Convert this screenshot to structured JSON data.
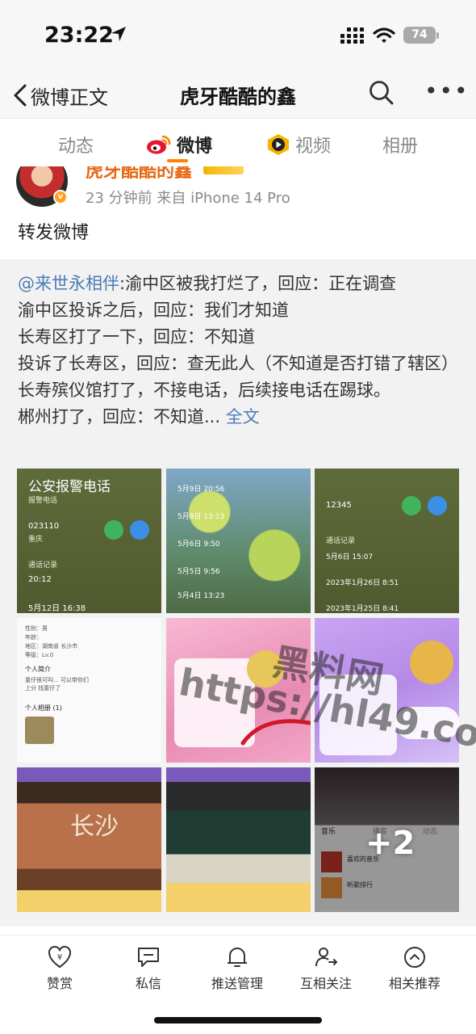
{
  "status_bar": {
    "time": "23:22",
    "battery": "74"
  },
  "nav": {
    "back_label": "微博正文",
    "title": "虎牙酷酷的鑫"
  },
  "tabs": [
    {
      "label": "动态",
      "active": false
    },
    {
      "label": "微博",
      "active": true
    },
    {
      "label": "视频",
      "active": false
    },
    {
      "label": "相册",
      "active": false
    }
  ],
  "post": {
    "author_name": "虎牙酷酷的鑫",
    "meta": "23 分钟前  来自 iPhone 14 Pro",
    "repost_label": "转发微博"
  },
  "quoted": {
    "mention": "@来世永相伴",
    "text": ":渝中区被我打烂了，回应：正在调查\n渝中区投诉之后，回应：我们才知道\n长寿区打了一下，回应：不知道\n投诉了长寿区，回应：查无此人（不知道是否打错了辖区）\n长寿殡仪馆打了，不接电话，后续接电话在踢球。\n郴州打了，回应：不知道...",
    "fulltext_label": "全文"
  },
  "images": {
    "img1": {
      "title": "公安报警电话",
      "sub": "报警电话",
      "num": "023110",
      "area": "重庆",
      "rec_label": "通话记录",
      "t1": "20:12",
      "t2": "5月12日 16:38"
    },
    "img2": {
      "rows": [
        "5月9日 20:56",
        "5月8日 13:13",
        "5月6日 9:50",
        "5月5日 9:56",
        "5月4日 13:23"
      ]
    },
    "img3": {
      "num": "12345",
      "rec_label": "通话记录",
      "rows": [
        "5月6日 15:07",
        "2023年1月26日 8:51",
        "2023年1月25日 8:41"
      ]
    },
    "img4": {
      "lines": [
        "性别：男",
        "年龄：",
        "地区：湖南省 长沙市",
        "等级：Lv.0"
      ],
      "intro_title": "个人简介",
      "intro": "童仔很可叫... 可以带你们上分 找童仔了",
      "album": "个人相册 (1)"
    },
    "img7": {
      "label": "长沙"
    },
    "img9": {
      "tab1": "音乐",
      "tab2": "播客",
      "tab3": "动态",
      "p1": "喜欢的音乐",
      "p2": "听歌排行",
      "more": "+2"
    }
  },
  "watermark": {
    "line1": "黑料网",
    "line2": "https://hl49.co"
  },
  "bottom_bar": {
    "items": [
      {
        "label": "赞赏",
        "icon": "reward-icon"
      },
      {
        "label": "私信",
        "icon": "message-icon"
      },
      {
        "label": "推送管理",
        "icon": "bell-icon"
      },
      {
        "label": "互相关注",
        "icon": "mutual-follow-icon"
      },
      {
        "label": "相关推荐",
        "icon": "recommend-icon"
      }
    ]
  }
}
